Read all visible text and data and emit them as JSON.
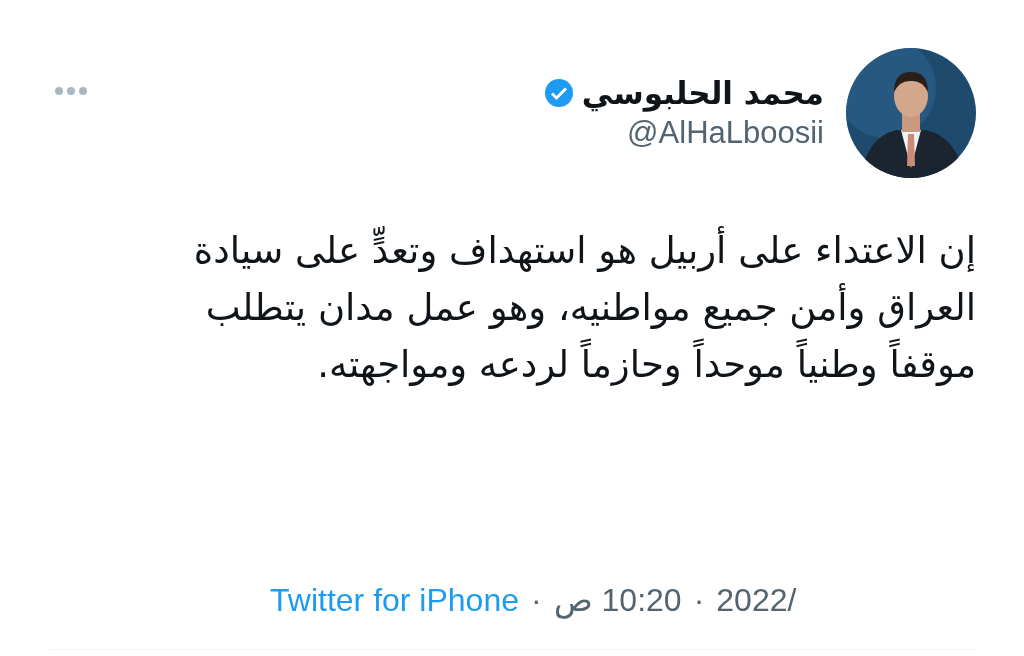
{
  "tweet": {
    "author": {
      "name": "محمد الحلبوسي",
      "verified": true,
      "handle": "@AlHaLboosii"
    },
    "text": "إن الاعتداء على أربيل هو استهداف وتعدٍّ على سيادة العراق وأمن جميع مواطنيه، وهو عمل مدان يتطلب موقفاً وطنياً موحداً وحازماً لردعه ومواجهته.",
    "footer": {
      "date": "2022/",
      "separator_1": "·",
      "time": "10:20 ص",
      "separator_2": "·",
      "source": "Twitter for iPhone"
    }
  }
}
